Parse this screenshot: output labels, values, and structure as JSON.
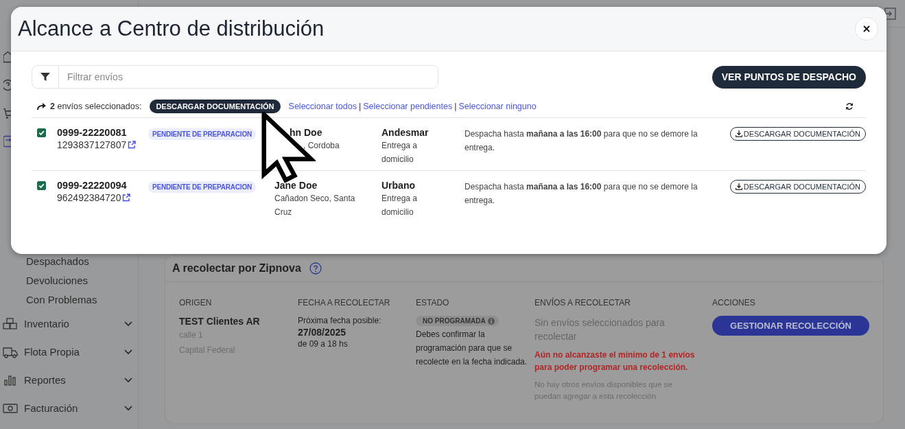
{
  "sidebar": {
    "items": [
      {
        "label": "Despachados",
        "kind": "sub"
      },
      {
        "label": "Devoluciones",
        "kind": "sub"
      },
      {
        "label": "Con Problemas",
        "kind": "sub"
      },
      {
        "label": "Inventario",
        "kind": "group"
      },
      {
        "label": "Flota Propia",
        "kind": "group"
      },
      {
        "label": "Reportes",
        "kind": "group"
      },
      {
        "label": "Facturación",
        "kind": "group"
      }
    ]
  },
  "pickup_card": {
    "title": "A recolectar por Zipnova",
    "columns": [
      "ORIGEN",
      "FECHA A RECOLECTAR",
      "ESTADO",
      "ENVÍOS A RECOLECTAR",
      "ACCIONES"
    ],
    "origin": {
      "name": "TEST Clientes AR",
      "street": "calle 1",
      "city": "Capital Federal"
    },
    "date": {
      "label": "Próxima fecha posible:",
      "value": "27/08/2025",
      "hours": "de 09 a 18 hs"
    },
    "status": {
      "badge": "NO PROGRAMADA",
      "text": "Debes confirmar la programación para que se recolecte en la fecha indicada."
    },
    "shipments": {
      "empty": "Sin envíos seleccionados para recolectar",
      "warning": "Aún no alcanzaste el mínimo de 1 envíos para poder programar una recolección.",
      "note": "No hay otros envíos disponibles que se puedan agregar a esta recolección"
    },
    "action_button": "GESTIONAR RECOLECCIÓN"
  },
  "modal": {
    "title": "Alcance a Centro de distribución",
    "filter": {
      "placeholder": "Filtrar envíos"
    },
    "dispatch_points_button": "VER PUNTOS DE DESPACHO",
    "selection": {
      "label": "**2** envíos seleccionados:",
      "download_button": "DESCARGAR DOCUMENTACIÓN",
      "links": [
        "Seleccionar todos",
        "Seleccionar pendientes",
        "Seleccionar ninguno"
      ],
      "separator": "|"
    },
    "rows": [
      {
        "checked": true,
        "order": "0999-22220081",
        "tracking": "1293837127807",
        "status": "PENDIENTE DE PREPARACION",
        "recipient": "hn Doe",
        "location": ", Cordoba",
        "carrier": "Andesmar",
        "service": "Entrega a domicilio",
        "note": "Despacha hasta **mañana a las 16:00** para que no se demore la entrega.",
        "button": "DESCARGAR DOCUMENTACIÓN"
      },
      {
        "checked": true,
        "order": "0999-22220094",
        "tracking": "962492384720",
        "status": "PENDIENTE DE PREPARACION",
        "recipient": "Jane Doe",
        "location": "Cañadon Seco, Santa Cruz",
        "carrier": "Urbano",
        "service": "Entrega a domicilio",
        "note": "Despacha hasta **mañana a las 16:00** para que no se demore la entrega.",
        "button": "DESCARGAR DOCUMENTACIÓN"
      }
    ]
  }
}
